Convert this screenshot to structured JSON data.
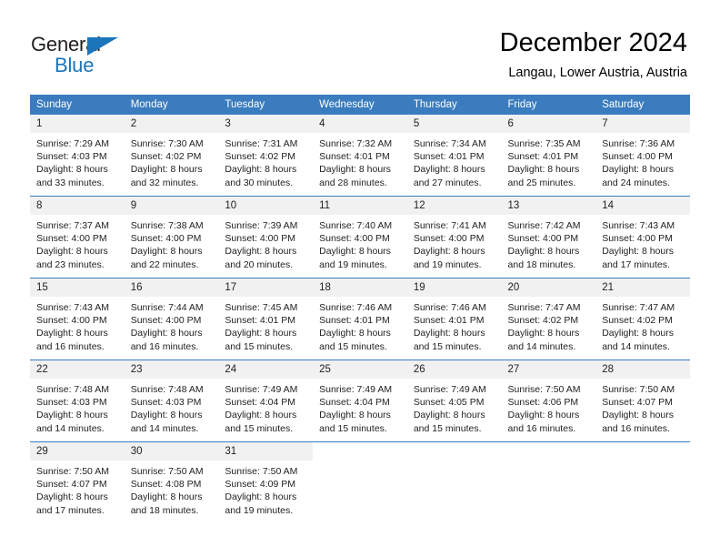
{
  "brand": {
    "word_general": "General",
    "word_blue": "Blue",
    "accent_color": "#1b75bb"
  },
  "header": {
    "title": "December 2024",
    "subtitle": "Langau, Lower Austria, Austria"
  },
  "calendar": {
    "header_color": "#3a7cbe",
    "daynum_bg": "#f1f1f1",
    "weekday_headers": [
      "Sunday",
      "Monday",
      "Tuesday",
      "Wednesday",
      "Thursday",
      "Friday",
      "Saturday"
    ],
    "weeks": [
      [
        {
          "day": "1",
          "sunrise": "Sunrise: 7:29 AM",
          "sunset": "Sunset: 4:03 PM",
          "daylight1": "Daylight: 8 hours",
          "daylight2": "and 33 minutes."
        },
        {
          "day": "2",
          "sunrise": "Sunrise: 7:30 AM",
          "sunset": "Sunset: 4:02 PM",
          "daylight1": "Daylight: 8 hours",
          "daylight2": "and 32 minutes."
        },
        {
          "day": "3",
          "sunrise": "Sunrise: 7:31 AM",
          "sunset": "Sunset: 4:02 PM",
          "daylight1": "Daylight: 8 hours",
          "daylight2": "and 30 minutes."
        },
        {
          "day": "4",
          "sunrise": "Sunrise: 7:32 AM",
          "sunset": "Sunset: 4:01 PM",
          "daylight1": "Daylight: 8 hours",
          "daylight2": "and 28 minutes."
        },
        {
          "day": "5",
          "sunrise": "Sunrise: 7:34 AM",
          "sunset": "Sunset: 4:01 PM",
          "daylight1": "Daylight: 8 hours",
          "daylight2": "and 27 minutes."
        },
        {
          "day": "6",
          "sunrise": "Sunrise: 7:35 AM",
          "sunset": "Sunset: 4:01 PM",
          "daylight1": "Daylight: 8 hours",
          "daylight2": "and 25 minutes."
        },
        {
          "day": "7",
          "sunrise": "Sunrise: 7:36 AM",
          "sunset": "Sunset: 4:00 PM",
          "daylight1": "Daylight: 8 hours",
          "daylight2": "and 24 minutes."
        }
      ],
      [
        {
          "day": "8",
          "sunrise": "Sunrise: 7:37 AM",
          "sunset": "Sunset: 4:00 PM",
          "daylight1": "Daylight: 8 hours",
          "daylight2": "and 23 minutes."
        },
        {
          "day": "9",
          "sunrise": "Sunrise: 7:38 AM",
          "sunset": "Sunset: 4:00 PM",
          "daylight1": "Daylight: 8 hours",
          "daylight2": "and 22 minutes."
        },
        {
          "day": "10",
          "sunrise": "Sunrise: 7:39 AM",
          "sunset": "Sunset: 4:00 PM",
          "daylight1": "Daylight: 8 hours",
          "daylight2": "and 20 minutes."
        },
        {
          "day": "11",
          "sunrise": "Sunrise: 7:40 AM",
          "sunset": "Sunset: 4:00 PM",
          "daylight1": "Daylight: 8 hours",
          "daylight2": "and 19 minutes."
        },
        {
          "day": "12",
          "sunrise": "Sunrise: 7:41 AM",
          "sunset": "Sunset: 4:00 PM",
          "daylight1": "Daylight: 8 hours",
          "daylight2": "and 19 minutes."
        },
        {
          "day": "13",
          "sunrise": "Sunrise: 7:42 AM",
          "sunset": "Sunset: 4:00 PM",
          "daylight1": "Daylight: 8 hours",
          "daylight2": "and 18 minutes."
        },
        {
          "day": "14",
          "sunrise": "Sunrise: 7:43 AM",
          "sunset": "Sunset: 4:00 PM",
          "daylight1": "Daylight: 8 hours",
          "daylight2": "and 17 minutes."
        }
      ],
      [
        {
          "day": "15",
          "sunrise": "Sunrise: 7:43 AM",
          "sunset": "Sunset: 4:00 PM",
          "daylight1": "Daylight: 8 hours",
          "daylight2": "and 16 minutes."
        },
        {
          "day": "16",
          "sunrise": "Sunrise: 7:44 AM",
          "sunset": "Sunset: 4:00 PM",
          "daylight1": "Daylight: 8 hours",
          "daylight2": "and 16 minutes."
        },
        {
          "day": "17",
          "sunrise": "Sunrise: 7:45 AM",
          "sunset": "Sunset: 4:01 PM",
          "daylight1": "Daylight: 8 hours",
          "daylight2": "and 15 minutes."
        },
        {
          "day": "18",
          "sunrise": "Sunrise: 7:46 AM",
          "sunset": "Sunset: 4:01 PM",
          "daylight1": "Daylight: 8 hours",
          "daylight2": "and 15 minutes."
        },
        {
          "day": "19",
          "sunrise": "Sunrise: 7:46 AM",
          "sunset": "Sunset: 4:01 PM",
          "daylight1": "Daylight: 8 hours",
          "daylight2": "and 15 minutes."
        },
        {
          "day": "20",
          "sunrise": "Sunrise: 7:47 AM",
          "sunset": "Sunset: 4:02 PM",
          "daylight1": "Daylight: 8 hours",
          "daylight2": "and 14 minutes."
        },
        {
          "day": "21",
          "sunrise": "Sunrise: 7:47 AM",
          "sunset": "Sunset: 4:02 PM",
          "daylight1": "Daylight: 8 hours",
          "daylight2": "and 14 minutes."
        }
      ],
      [
        {
          "day": "22",
          "sunrise": "Sunrise: 7:48 AM",
          "sunset": "Sunset: 4:03 PM",
          "daylight1": "Daylight: 8 hours",
          "daylight2": "and 14 minutes."
        },
        {
          "day": "23",
          "sunrise": "Sunrise: 7:48 AM",
          "sunset": "Sunset: 4:03 PM",
          "daylight1": "Daylight: 8 hours",
          "daylight2": "and 14 minutes."
        },
        {
          "day": "24",
          "sunrise": "Sunrise: 7:49 AM",
          "sunset": "Sunset: 4:04 PM",
          "daylight1": "Daylight: 8 hours",
          "daylight2": "and 15 minutes."
        },
        {
          "day": "25",
          "sunrise": "Sunrise: 7:49 AM",
          "sunset": "Sunset: 4:04 PM",
          "daylight1": "Daylight: 8 hours",
          "daylight2": "and 15 minutes."
        },
        {
          "day": "26",
          "sunrise": "Sunrise: 7:49 AM",
          "sunset": "Sunset: 4:05 PM",
          "daylight1": "Daylight: 8 hours",
          "daylight2": "and 15 minutes."
        },
        {
          "day": "27",
          "sunrise": "Sunrise: 7:50 AM",
          "sunset": "Sunset: 4:06 PM",
          "daylight1": "Daylight: 8 hours",
          "daylight2": "and 16 minutes."
        },
        {
          "day": "28",
          "sunrise": "Sunrise: 7:50 AM",
          "sunset": "Sunset: 4:07 PM",
          "daylight1": "Daylight: 8 hours",
          "daylight2": "and 16 minutes."
        }
      ],
      [
        {
          "day": "29",
          "sunrise": "Sunrise: 7:50 AM",
          "sunset": "Sunset: 4:07 PM",
          "daylight1": "Daylight: 8 hours",
          "daylight2": "and 17 minutes."
        },
        {
          "day": "30",
          "sunrise": "Sunrise: 7:50 AM",
          "sunset": "Sunset: 4:08 PM",
          "daylight1": "Daylight: 8 hours",
          "daylight2": "and 18 minutes."
        },
        {
          "day": "31",
          "sunrise": "Sunrise: 7:50 AM",
          "sunset": "Sunset: 4:09 PM",
          "daylight1": "Daylight: 8 hours",
          "daylight2": "and 19 minutes."
        },
        {
          "day": "",
          "sunrise": "",
          "sunset": "",
          "daylight1": "",
          "daylight2": ""
        },
        {
          "day": "",
          "sunrise": "",
          "sunset": "",
          "daylight1": "",
          "daylight2": ""
        },
        {
          "day": "",
          "sunrise": "",
          "sunset": "",
          "daylight1": "",
          "daylight2": ""
        },
        {
          "day": "",
          "sunrise": "",
          "sunset": "",
          "daylight1": "",
          "daylight2": ""
        }
      ]
    ]
  }
}
